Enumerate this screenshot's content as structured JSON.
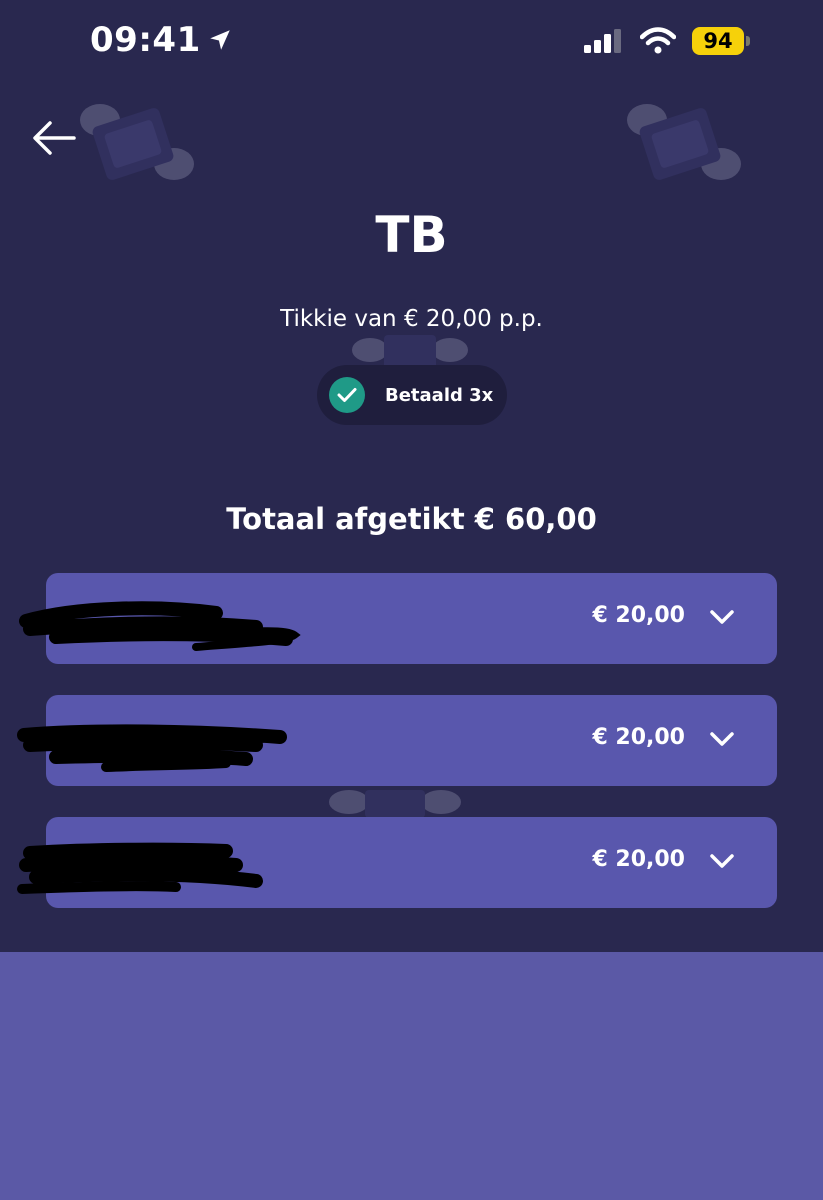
{
  "status_bar": {
    "time": "09:41",
    "battery": "94"
  },
  "header": {
    "title": "TB",
    "subtitle": "Tikkie van € 20,00 p.p."
  },
  "paid_badge": {
    "label": "Betaald 3x"
  },
  "total": {
    "label": "Totaal afgetikt € 60,00"
  },
  "payments": [
    {
      "amount": "€ 20,00"
    },
    {
      "amount": "€ 20,00"
    },
    {
      "amount": "€ 20,00"
    }
  ],
  "colors": {
    "background_dark": "#29284f",
    "background_light": "#5b59a6",
    "row": "#5957ad",
    "check": "#1f9a87",
    "battery": "#f6d10a"
  }
}
